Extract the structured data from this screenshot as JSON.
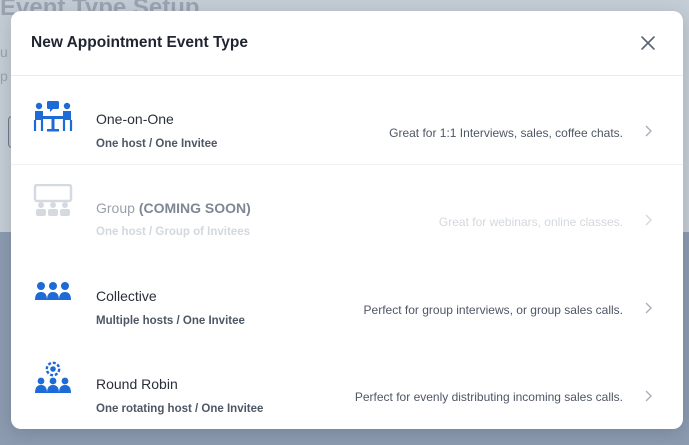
{
  "background": {
    "title": "Event Type Setup",
    "frag1": "u",
    "frag2": "p"
  },
  "modal": {
    "title": "New Appointment Event Type",
    "options": [
      {
        "title": "One-on-One",
        "extra": "",
        "subtitle": "One host / One Invitee",
        "description": "Great for 1:1 Interviews, sales, coffee chats.",
        "icon": "one-on-one-meeting-icon",
        "enabled": true
      },
      {
        "title": "Group",
        "extra": "(COMING SOON)",
        "subtitle": "One host / Group of Invitees",
        "description": "Great for webinars, online classes.",
        "icon": "group-presentation-icon",
        "enabled": false
      },
      {
        "title": "Collective",
        "extra": "",
        "subtitle": "Multiple hosts / One Invitee",
        "description": "Perfect for group interviews, or group sales calls.",
        "icon": "multiple-people-icon",
        "enabled": true
      },
      {
        "title": "Round Robin",
        "extra": "",
        "subtitle": "One rotating host / One Invitee",
        "description": "Perfect for evenly distributing incoming sales calls.",
        "icon": "round-robin-icon",
        "enabled": true
      }
    ]
  },
  "colors": {
    "accent": "#1e6ad6",
    "disabled_icon": "#d5dae1"
  }
}
